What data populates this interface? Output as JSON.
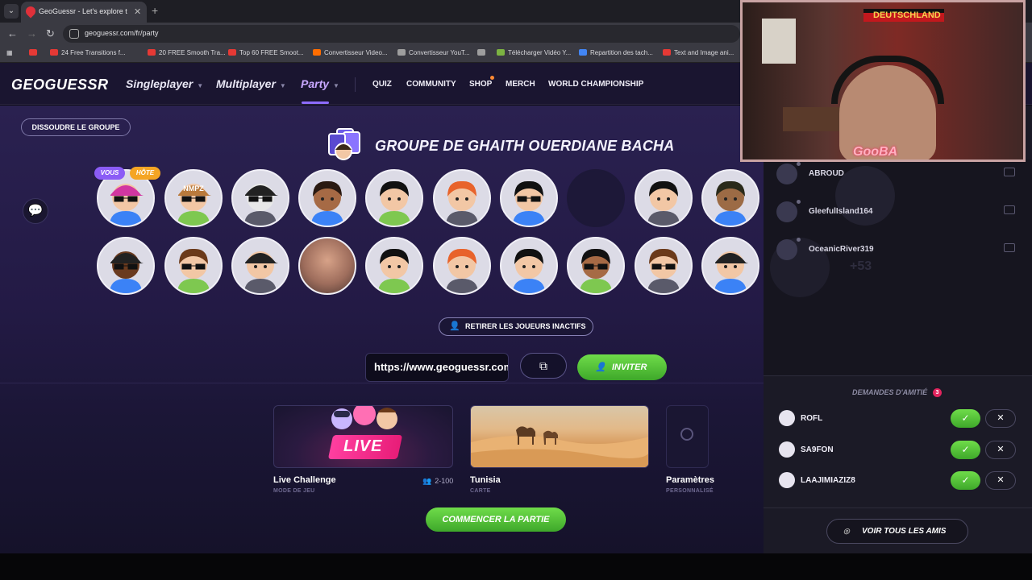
{
  "browser": {
    "tab_title": "GeoGuessr - Let's explore the w",
    "url": "geoguessr.com/fr/party",
    "bookmarks": [
      {
        "label": "",
        "color": "#e53935"
      },
      {
        "label": "24 Free Transitions f...",
        "color": "#e53935"
      },
      {
        "label": "20 FREE Smooth Tra...",
        "color": "#e53935"
      },
      {
        "label": "Top 60 FREE Smoot...",
        "color": "#e53935"
      },
      {
        "label": "Convertisseur Video...",
        "color": "#ff6d00"
      },
      {
        "label": "Convertisseur YouT...",
        "color": "#9e9e9e"
      },
      {
        "label": "",
        "color": "#9e9e9e"
      },
      {
        "label": "Télécharger Vidéo Y...",
        "color": "#7cb342"
      },
      {
        "label": "Repartition des tach...",
        "color": "#4285f4"
      },
      {
        "label": "Text and Image ani...",
        "color": "#e53935"
      }
    ]
  },
  "header": {
    "logo": "GEOGUESSR",
    "nav_singleplayer": "Singleplayer",
    "nav_multiplayer": "Multiplayer",
    "nav_party": "Party",
    "nav_quiz": "QUIZ",
    "nav_community": "COMMUNITY",
    "nav_shop": "SHOP",
    "nav_merch": "MERCH",
    "nav_world_championship": "WORLD CHAMPIONSHIP"
  },
  "party": {
    "dissolve_button": "DISSOUDRE LE GROUPE",
    "group_title": "GROUPE DE GHAITH OUERDIANE BACHA",
    "badge_you": "VOUS",
    "badge_host": "HÔTE",
    "remove_inactive_button": "RETIRER LES JOUEURS INACTIFS",
    "invite_url": "https://www.geoguessr.com/join",
    "invite_button": "INVITER",
    "start_button": "COMMENCER LA PARTIE",
    "cards": {
      "live_banner": "LIVE",
      "live_title": "Live Challenge",
      "live_sub": "MODE DE JEU",
      "players": "2-100",
      "map_title": "Tunisia",
      "map_sub": "CARTE",
      "settings_title": "Paramètres",
      "settings_sub": "PERSONNALISÉ"
    },
    "avatars_row1": [
      {
        "hair": "#7b2fb8",
        "skin": "#f2c7a5",
        "cap": "#d236a0",
        "glasses": true,
        "cap_text": ""
      },
      {
        "hair": "#b97a3c",
        "skin": "#f2c7a5",
        "cap": "#b97a3c",
        "glasses": true,
        "cap_text": "NMPZ"
      },
      {
        "hair": "#222",
        "skin": "#e8e8e8",
        "cap": "#222",
        "glasses": true,
        "cap_text": ""
      },
      {
        "hair": "#2a1a12",
        "skin": "#a66a45",
        "cap": "",
        "glasses": false,
        "cap_text": ""
      },
      {
        "hair": "#111",
        "skin": "#f2c7a5",
        "cap": "",
        "glasses": false,
        "cap_text": ""
      },
      {
        "hair": "#e8632b",
        "skin": "#f2c7a5",
        "cap": "",
        "glasses": false,
        "cap_text": ""
      },
      {
        "hair": "#111",
        "skin": "#f2c7a5",
        "cap": "",
        "glasses": true,
        "cap_text": ""
      },
      {
        "empty": true
      },
      {
        "hair": "#111",
        "skin": "#f2c7a5",
        "cap": "",
        "glasses": false,
        "cap_text": ""
      },
      {
        "hair": "#2a2a1a",
        "skin": "#9c6b45",
        "cap": "",
        "glasses": false,
        "cap_text": ""
      }
    ],
    "avatars_row2": [
      {
        "hair": "#222",
        "skin": "#6a3a1e",
        "cap": "#222",
        "glasses": true,
        "cap_text": ""
      },
      {
        "hair": "#6b3a1a",
        "skin": "#f2c7a5",
        "cap": "",
        "glasses": true,
        "cap_text": ""
      },
      {
        "hair": "#222",
        "skin": "#f2c7a5",
        "cap": "#222",
        "glasses": false,
        "cap_text": ""
      },
      {
        "photo": true
      },
      {
        "hair": "#111",
        "skin": "#f2c7a5",
        "cap": "",
        "glasses": false,
        "cap_text": ""
      },
      {
        "hair": "#e8632b",
        "skin": "#f2c7a5",
        "cap": "",
        "glasses": false,
        "cap_text": ""
      },
      {
        "hair": "#111",
        "skin": "#f2c7a5",
        "cap": "",
        "glasses": false,
        "cap_text": ""
      },
      {
        "hair": "#111",
        "skin": "#a66a45",
        "cap": "",
        "glasses": true,
        "cap_text": ""
      },
      {
        "hair": "#6b3a1a",
        "skin": "#f2c7a5",
        "cap": "",
        "glasses": true,
        "cap_text": ""
      },
      {
        "hair": "#222",
        "skin": "#f2c7a5",
        "cap": "#222",
        "glasses": false,
        "cap_text": ""
      }
    ]
  },
  "friends": {
    "online": [
      {
        "name": "ABROUD"
      },
      {
        "name": "GleefulIsland164"
      },
      {
        "name": "OceanicRiver319"
      }
    ],
    "more_count": "+53",
    "requests_title": "DEMANDES D'AMITIÉ",
    "requests_count": "3",
    "requests": [
      {
        "name": "ROFL"
      },
      {
        "name": "SA9FON"
      },
      {
        "name": "LAAJIMIAZIZ8"
      }
    ],
    "view_all_button": "VOIR TOUS LES AMIS"
  },
  "webcam": {
    "flag_text": "DEUTSCHLAND",
    "tag": "GooBA"
  },
  "colors": {
    "accent": "#8d6cff",
    "green": "#4fc236",
    "badge_you": "#8b5cf6",
    "badge_host": "#f5a524"
  }
}
